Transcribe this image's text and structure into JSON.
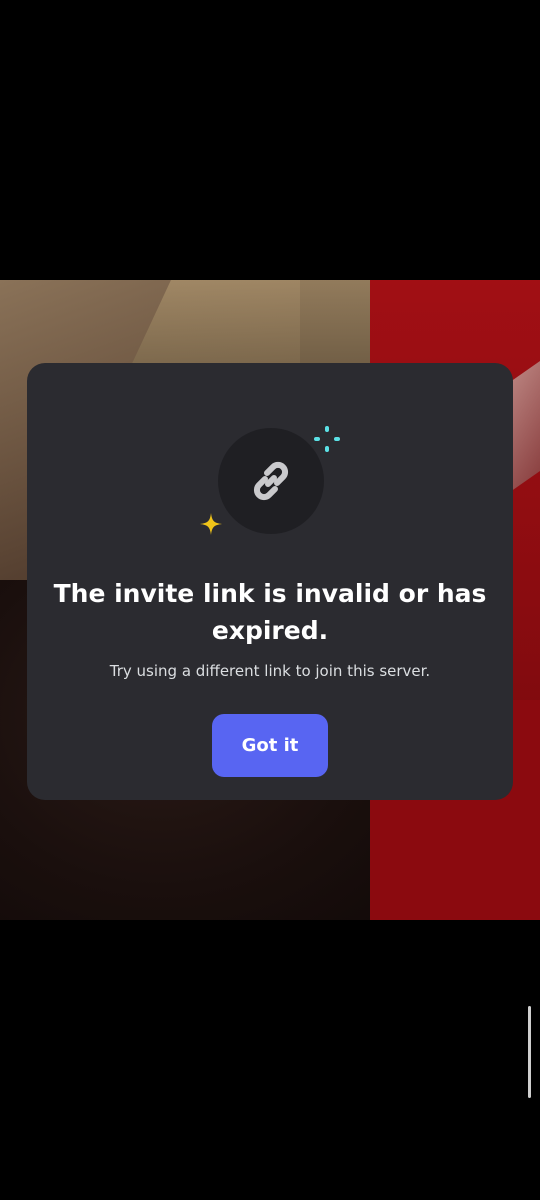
{
  "dialog": {
    "title": "The invite link is invalid or has expired.",
    "message": "Try using a different link to join this server.",
    "confirm_label": "Got it"
  },
  "icons": {
    "main": "link-icon",
    "decor_1": "sparkle-icon",
    "decor_2": "star-icon"
  },
  "colors": {
    "dialog_background": "#2b2b30",
    "icon_circle": "#1f1f23",
    "button": "#5865f2",
    "sparkle_teal": "#5ce1e6",
    "sparkle_gold": "#f0c419"
  }
}
